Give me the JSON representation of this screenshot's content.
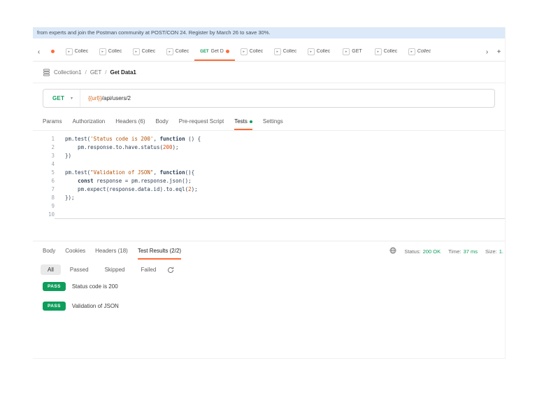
{
  "banner": {
    "text": "from experts and join the Postman community at POST/CON 24. Register by March 26 to save 30%."
  },
  "icons": {
    "scroll_left": "‹",
    "scroll_right": "›",
    "new_tab": "+",
    "tab_method_glyph": "▸",
    "chevron_down": "▾"
  },
  "tabbar": {
    "tabs": [
      {
        "dirty": true
      },
      {
        "label": "Collec",
        "icon": true
      },
      {
        "label": "Collec",
        "icon": true
      },
      {
        "label": "Collec",
        "icon": true
      },
      {
        "label": "Collec",
        "icon": true
      },
      {
        "method": "GET",
        "label": "Get D",
        "dirty": true,
        "active": true
      },
      {
        "label": "Collec",
        "icon": true
      },
      {
        "label": "Collec",
        "icon": true
      },
      {
        "label": "Collec",
        "icon": true
      },
      {
        "label": "GET",
        "icon": true
      },
      {
        "label": "Collec",
        "icon": true
      },
      {
        "label": "Collec",
        "icon": true,
        "italic": true
      }
    ]
  },
  "breadcrumb": {
    "separator": "/",
    "items": [
      "Collection1",
      "GET",
      "Get Data1"
    ]
  },
  "request": {
    "method": "GET",
    "url_variable": "{{url}}",
    "url_path": "/api/users/2"
  },
  "request_tabs": [
    {
      "label": "Params"
    },
    {
      "label": "Authorization"
    },
    {
      "label": "Headers (6)"
    },
    {
      "label": "Body"
    },
    {
      "label": "Pre-request Script"
    },
    {
      "label": "Tests",
      "active": true,
      "dot": true
    },
    {
      "label": "Settings"
    }
  ],
  "editor": {
    "lines": [
      {
        "num": 1,
        "tokens": [
          {
            "t": "pm.test("
          },
          {
            "t": "'Status code is 200'",
            "c": "str"
          },
          {
            "t": ", "
          },
          {
            "t": "function",
            "c": "kw"
          },
          {
            "t": " () {"
          }
        ]
      },
      {
        "num": 2,
        "tokens": [
          {
            "t": "    pm.response.to.have.status("
          },
          {
            "t": "200",
            "c": "num"
          },
          {
            "t": ");"
          }
        ]
      },
      {
        "num": 3,
        "tokens": [
          {
            "t": "})"
          }
        ]
      },
      {
        "num": 4,
        "tokens": []
      },
      {
        "num": 5,
        "tokens": [
          {
            "t": "pm.test("
          },
          {
            "t": "\"Validation of JSON\"",
            "c": "str"
          },
          {
            "t": ", "
          },
          {
            "t": "function",
            "c": "kw"
          },
          {
            "t": "(){"
          }
        ]
      },
      {
        "num": 6,
        "tokens": [
          {
            "t": "    "
          },
          {
            "t": "const",
            "c": "kw"
          },
          {
            "t": " response = pm.response.json();"
          }
        ]
      },
      {
        "num": 7,
        "tokens": [
          {
            "t": "    pm.expect(response.data.id).to.eql("
          },
          {
            "t": "2",
            "c": "num"
          },
          {
            "t": ");"
          }
        ]
      },
      {
        "num": 8,
        "tokens": [
          {
            "t": "});"
          }
        ]
      },
      {
        "num": 9,
        "tokens": []
      },
      {
        "num": 10,
        "tokens": [],
        "cursor": true
      }
    ]
  },
  "response": {
    "tabs": [
      {
        "label": "Body"
      },
      {
        "label": "Cookies"
      },
      {
        "label": "Headers (18)"
      },
      {
        "label": "Test Results (2/2)",
        "active": true
      }
    ],
    "meta": [
      {
        "label": "Status:",
        "value": "200 OK"
      },
      {
        "label": "Time:",
        "value": "37 ms"
      },
      {
        "label": "Size:",
        "value": "1."
      }
    ],
    "filters": [
      {
        "label": "All",
        "active": true
      },
      {
        "label": "Passed"
      },
      {
        "label": "Skipped"
      },
      {
        "label": "Failed"
      }
    ],
    "results": [
      {
        "badge": "PASS",
        "text": "Status code is 200"
      },
      {
        "badge": "PASS",
        "text": "Validation of JSON"
      }
    ]
  },
  "colors": {
    "orange": "#ff6c37",
    "green": "#0e9e5b",
    "banner_bg": "#dbe9f8",
    "code_string": "#b45309",
    "code_number": "#d9480f",
    "url_variable": "#d4671e"
  }
}
